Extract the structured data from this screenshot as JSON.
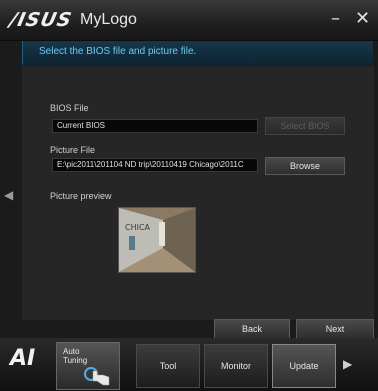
{
  "window": {
    "logo_text": "/ISUS",
    "title": "MyLogo",
    "minimize_label": "–",
    "close_label": "✕"
  },
  "header": {
    "instruction": "Select the BIOS file and picture file."
  },
  "bios": {
    "label": "BIOS File",
    "value": "Current BIOS",
    "button_label": "Select BIOS"
  },
  "picture": {
    "label": "Picture File",
    "value": "E:\\pic2011\\201104 ND trip\\20110419 Chicago\\2011C",
    "browse_label": "Browse"
  },
  "preview": {
    "label": "Picture preview"
  },
  "nav": {
    "back_label": "Back",
    "next_label": "Next"
  },
  "bottom": {
    "ai_logo_text": "AI",
    "auto_tuning_label_line1": "Auto",
    "auto_tuning_label_line2": "Tuning",
    "tabs": [
      {
        "label": "Tool"
      },
      {
        "label": "Monitor"
      },
      {
        "label": "Update"
      }
    ]
  },
  "icons": {
    "left_arrow": "left-arrow-icon",
    "right_arrow": "right-arrow-icon",
    "pointer": "hand-pointer-icon"
  },
  "colors": {
    "accent": "#6ec9f5",
    "background": "#1b1b1b"
  }
}
